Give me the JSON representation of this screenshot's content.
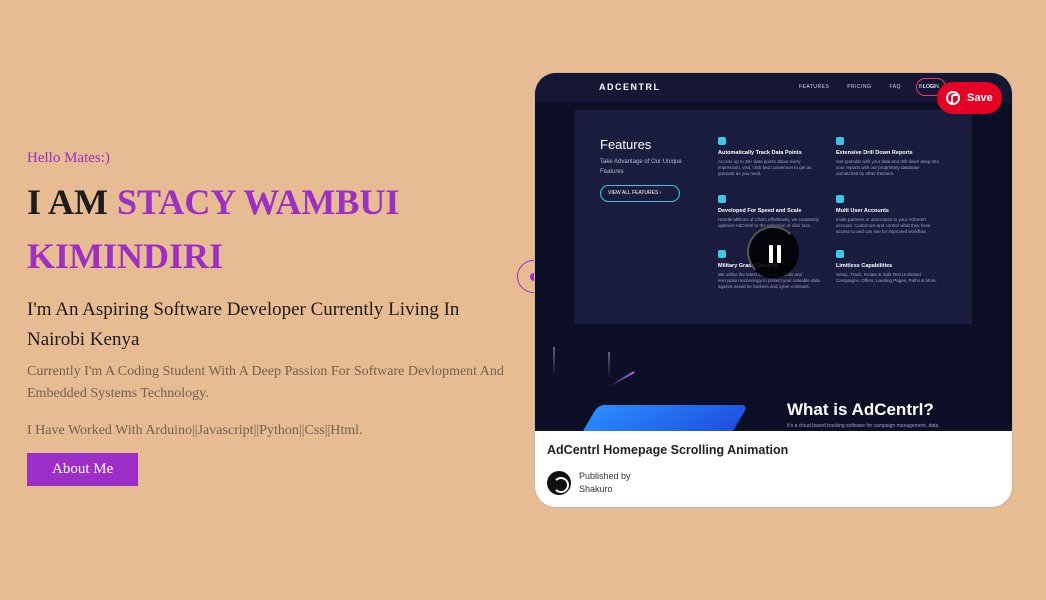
{
  "hero": {
    "greeting": "Hello Mates:)",
    "name_prefix": "I AM ",
    "name_first": "STACY WAMBUI",
    "name_last": "KIMINDIRI",
    "tagline": "I'm An Aspiring Software Developer Currently Living In Nairobi Kenya",
    "description": "Currently I'm A Coding Student With A Deep Passion For Software Devlopment And Embedded Systems Technology.",
    "stack": "I Have Worked With Arduino||Javascript||Python||Css||Html.",
    "about_button": "About Me"
  },
  "pin_card": {
    "save_label": "Save",
    "title": "AdCentrl Homepage Scrolling Animation",
    "published_label": "Published by",
    "publisher": "Shakuro",
    "media": {
      "logo": "ADCENTRL",
      "nav": [
        "FEATURES",
        "PRICING",
        "FAQ",
        "BLOG"
      ],
      "login": "LOGIN",
      "features_title": "Features",
      "features_sub": "Take Advantage of Our Unique Features",
      "view_all": "VIEW ALL FEATURES",
      "items": [
        {
          "title": "Automatically Track Data Points",
          "desc": "Access up to 30+ data points about every impression, visit, click and conversion to get as granular as you need."
        },
        {
          "title": "Extensive Drill Down Reports",
          "desc": "Get granular with your data and drill down deep into your reports with our proprietary database unmatched by other trackers."
        },
        {
          "title": "Developed For Speed and Scale",
          "desc": "Handle Millions of Clicks effortlessly, we constantly optimize AdCentrl to the reduction of click loss."
        },
        {
          "title": "Multi User Accounts",
          "desc": "Invite partners or associates to your AdCentrl account. Customize and control what they have access to and can see for improved workflow."
        },
        {
          "title": "Military Grade Security",
          "desc": "We utilize the latest security protocols and encryption technology to protect your valuable data against would be hackers and cyber criminals."
        },
        {
          "title": "Limitless Capabilities",
          "desc": "Setup, Track, Rotate & Split Test Unlimited Campaigns, Offers, Landing Pages, Paths & More."
        }
      ],
      "what_title": "What is AdCentrl?",
      "what_sub": "It's a cloud based tracking software for campaign management, data"
    }
  },
  "colors": {
    "background": "#e8bc92",
    "accent": "#9b2fc8",
    "pinterest_red": "#e60023"
  },
  "icons": [
    "pinterest-icon",
    "pause-icon",
    "publisher-avatar"
  ]
}
